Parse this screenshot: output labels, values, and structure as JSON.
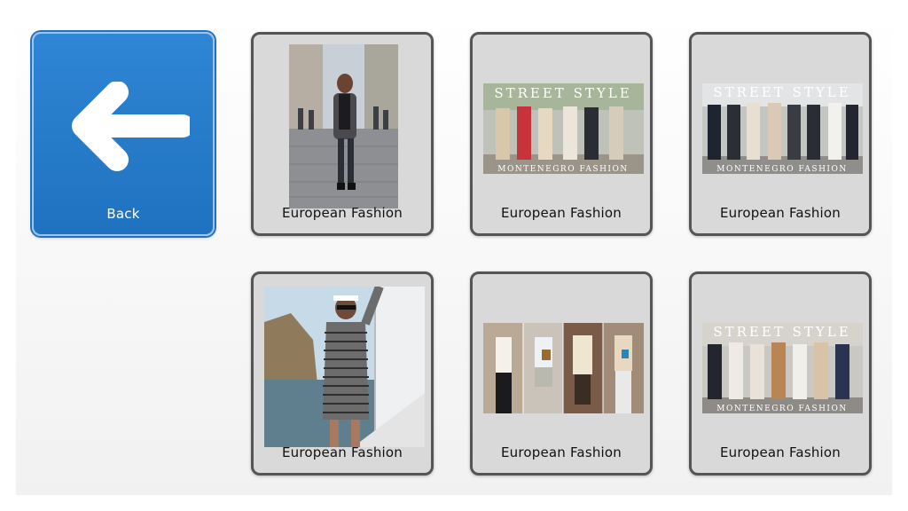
{
  "back": {
    "label": "Back",
    "icon": "arrow-left-icon"
  },
  "tiles": [
    {
      "label": "European Fashion",
      "image": "woman-walking-cobblestone-street-photo"
    },
    {
      "label": "European Fashion",
      "image": "street-style-group-photo",
      "overlay_top": "STREET STYLE",
      "overlay_bottom": "MONTENEGRO FASHION"
    },
    {
      "label": "European Fashion",
      "image": "street-style-group-photo",
      "overlay_top": "STREET STYLE",
      "overlay_bottom": "MONTENEGRO FASHION"
    },
    {
      "label": "European Fashion",
      "image": "woman-on-yacht-photo"
    },
    {
      "label": "European Fashion",
      "image": "street-style-collage-photo"
    },
    {
      "label": "European Fashion",
      "image": "street-style-group-photo",
      "overlay_top": "STREET STYLE",
      "overlay_bottom": "MONTENEGRO FASHION"
    }
  ],
  "colors": {
    "back_blue": "#2a7fcc",
    "tile_gray": "#d9d9d9",
    "tile_border": "#555555"
  }
}
